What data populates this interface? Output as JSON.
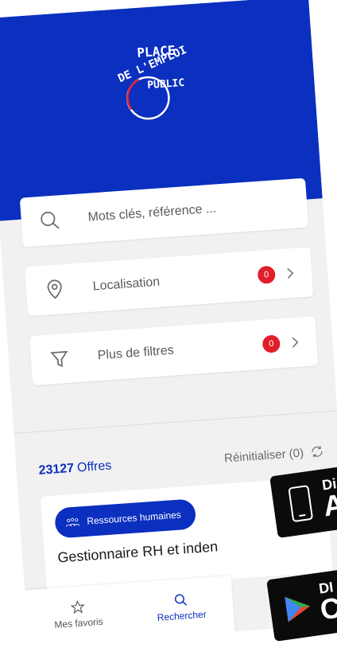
{
  "logo": {
    "text": "DE L'EMPLOI PLACE PUBLIC"
  },
  "search": {
    "placeholder": "Mots clés, référence ..."
  },
  "location": {
    "label": "Localisation",
    "badge": "0"
  },
  "filters": {
    "label": "Plus de filtres",
    "badge": "0"
  },
  "results": {
    "count": "23127",
    "label": "Offres",
    "reset": "Réinitialiser (0)"
  },
  "offer": {
    "tag": "Ressources humaines",
    "title": "Gestionnaire RH et inden"
  },
  "nav": {
    "favorites": "Mes favoris",
    "search": "Rechercher"
  },
  "store": {
    "apple_top": "Di",
    "apple_big": "A",
    "google_top": "DI",
    "google_big": "C"
  }
}
